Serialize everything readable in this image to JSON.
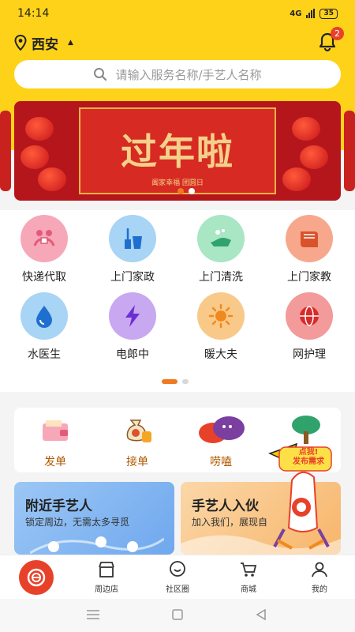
{
  "status": {
    "time": "14:14",
    "network": "4G",
    "battery": "35"
  },
  "location": {
    "city": "西安"
  },
  "notifications": {
    "count": "2"
  },
  "search": {
    "placeholder": "请输入服务名称/手艺人名称"
  },
  "banner": {
    "title": "过年啦",
    "subtitle": "阖家幸福 团圆日"
  },
  "services": [
    {
      "label": "快递代取",
      "icon": "courier-handover-icon",
      "color": "#f7a8b8"
    },
    {
      "label": "上门家政",
      "icon": "cleaning-supplies-icon",
      "color": "#a8d4f5"
    },
    {
      "label": "上门清洗",
      "icon": "wash-hand-icon",
      "color": "#a8e6c4"
    },
    {
      "label": "上门家教",
      "icon": "book-icon",
      "color": "#f7a88c"
    },
    {
      "label": "水医生",
      "icon": "water-drop-icon",
      "color": "#a8d4f5"
    },
    {
      "label": "电郎中",
      "icon": "lightning-icon",
      "color": "#c8a8f0"
    },
    {
      "label": "暖大夫",
      "icon": "sun-icon",
      "color": "#f9c98a"
    },
    {
      "label": "网护理",
      "icon": "globe-icon",
      "color": "#f39a9a"
    }
  ],
  "quick_actions": [
    {
      "label": "发单"
    },
    {
      "label": "接单"
    },
    {
      "label": "唠嗑"
    }
  ],
  "cards": {
    "nearby": {
      "title": "附近手艺人",
      "subtitle": "锁定周边，无需太多寻觅"
    },
    "join": {
      "title": "手艺人入伙",
      "subtitle": "加入我们，展现自"
    }
  },
  "float_ad": {
    "line1": "点我!",
    "line2": "发布需求"
  },
  "tabs": [
    {
      "label": "周边店"
    },
    {
      "label": "社区圈"
    },
    {
      "label": "商城"
    },
    {
      "label": "我的"
    }
  ]
}
